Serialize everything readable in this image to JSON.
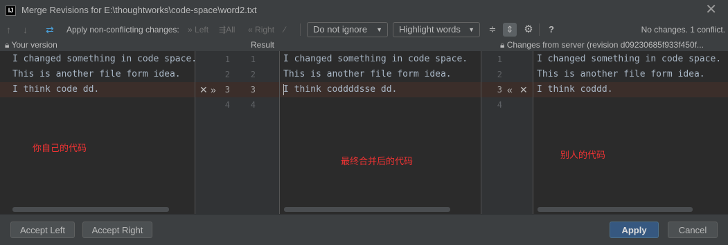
{
  "window": {
    "logo_text": "IJ",
    "title": "Merge Revisions for E:\\thoughtworks\\code-space\\word2.txt",
    "close_icon": "close-icon"
  },
  "toolbar": {
    "up_icon": "arrow-up-icon",
    "down_icon": "arrow-down-icon",
    "magic_icon": "magic-resolve-icon",
    "apply_label": "Apply non-conflicting changes:",
    "left_label": "Left",
    "all_label": "All",
    "right_label": "Right",
    "ignore_select": "Do not ignore",
    "highlight_select": "Highlight words",
    "status": "No changes. 1 conflict."
  },
  "headers": {
    "left": "Your version",
    "center": "Result",
    "right": "Changes from server (revision d09230685f933f450f..."
  },
  "left_pane": {
    "lines": [
      "I changed something in code space.",
      "This is another file form idea.",
      "I think code dd."
    ],
    "annotation": "你自己的代码"
  },
  "result_pane": {
    "lines": [
      "I changed something in code space.",
      "This is another file form idea.",
      "I think coddddsse dd."
    ],
    "annotation": "最终合并后的代码"
  },
  "right_pane": {
    "lines": [
      "I changed something in code space.",
      "This is another file form idea.",
      "I think coddd."
    ],
    "annotation": "别人的代码"
  },
  "gutter_left": {
    "left_nums": [
      "1",
      "2",
      "3",
      "4"
    ],
    "right_nums": [
      "1",
      "2",
      "3",
      "4"
    ]
  },
  "gutter_right": {
    "nums": [
      "1",
      "2",
      "3",
      "4"
    ]
  },
  "footer": {
    "accept_left": "Accept Left",
    "accept_right": "Accept Right",
    "apply": "Apply",
    "cancel": "Cancel"
  },
  "colors": {
    "conflict_bg": "#3b2e2a",
    "annotation": "#ee3333",
    "primary": "#365880"
  }
}
